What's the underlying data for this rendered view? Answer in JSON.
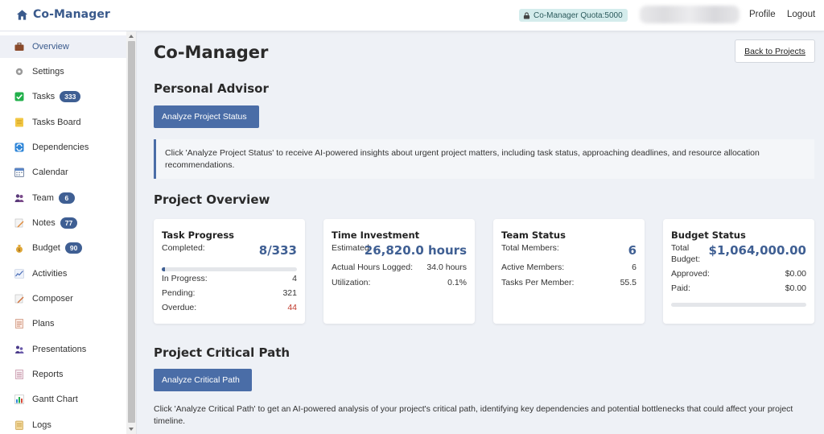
{
  "app": {
    "title": "Co-Manager"
  },
  "header": {
    "quota": "Co-Manager Quota:5000",
    "profile": "Profile",
    "logout": "Logout"
  },
  "sidebar": {
    "items": [
      {
        "label": "Overview",
        "icon": "briefcase-icon",
        "active": true
      },
      {
        "label": "Settings",
        "icon": "gear-icon"
      },
      {
        "label": "Tasks",
        "icon": "checkbox-icon",
        "badge": "333"
      },
      {
        "label": "Tasks Board",
        "icon": "notepad-icon"
      },
      {
        "label": "Dependencies",
        "icon": "arrows-icon"
      },
      {
        "label": "Calendar",
        "icon": "calendar-icon"
      },
      {
        "label": "Team",
        "icon": "people-icon",
        "badge": "6"
      },
      {
        "label": "Notes",
        "icon": "pencil-icon",
        "badge": "77"
      },
      {
        "label": "Budget",
        "icon": "moneybag-icon",
        "badge": "90"
      },
      {
        "label": "Activities",
        "icon": "pulse-icon"
      },
      {
        "label": "Composer",
        "icon": "edit-icon"
      },
      {
        "label": "Plans",
        "icon": "document-icon"
      },
      {
        "label": "Presentations",
        "icon": "presenter-icon"
      },
      {
        "label": "Reports",
        "icon": "report-icon"
      },
      {
        "label": "Gantt Chart",
        "icon": "bar-chart-icon"
      },
      {
        "label": "Logs",
        "icon": "scroll-icon"
      }
    ]
  },
  "main": {
    "title": "Co-Manager",
    "back_button": "Back to Projects",
    "advisor": {
      "title": "Personal Advisor",
      "button": "Analyze Project Status",
      "info": "Click 'Analyze Project Status' to receive AI-powered insights about urgent project matters, including task status, approaching deadlines, and resource allocation recommendations."
    },
    "overview": {
      "title": "Project Overview",
      "task_progress": {
        "title": "Task Progress",
        "completed_label": "Completed:",
        "completed_value": "8/333",
        "progress_fraction": 0.024,
        "in_progress_label": "In Progress:",
        "in_progress_value": "4",
        "pending_label": "Pending:",
        "pending_value": "321",
        "overdue_label": "Overdue:",
        "overdue_value": "44"
      },
      "time_investment": {
        "title": "Time Investment",
        "estimated_label": "Estimated:",
        "estimated_value": "26,820.0 hours",
        "logged_label": "Actual Hours Logged:",
        "logged_value": "34.0 hours",
        "utilization_label": "Utilization:",
        "utilization_value": "0.1%"
      },
      "team_status": {
        "title": "Team Status",
        "total_label": "Total Members:",
        "total_value": "6",
        "active_label": "Active Members:",
        "active_value": "6",
        "per_member_label": "Tasks Per Member:",
        "per_member_value": "55.5"
      },
      "budget_status": {
        "title": "Budget Status",
        "total_label_1": "Total",
        "total_label_2": "Budget:",
        "total_value": "$1,064,000.00",
        "approved_label": "Approved:",
        "approved_value": "$0.00",
        "paid_label": "Paid:",
        "paid_value": "$0.00",
        "spent_fraction": 0
      }
    },
    "critical_path": {
      "title": "Project Critical Path",
      "button": "Analyze Critical Path",
      "info": "Click 'Analyze Critical Path' to get an AI-powered analysis of your project's critical path, identifying key dependencies and potential bottlenecks that could affect your project timeline."
    }
  },
  "colors": {
    "brand": "#3a5a8c",
    "primary_button": "#4a6da7",
    "badge": "#3f5f93",
    "overdue": "#c0392b",
    "quota_bg": "#d4ecec"
  }
}
